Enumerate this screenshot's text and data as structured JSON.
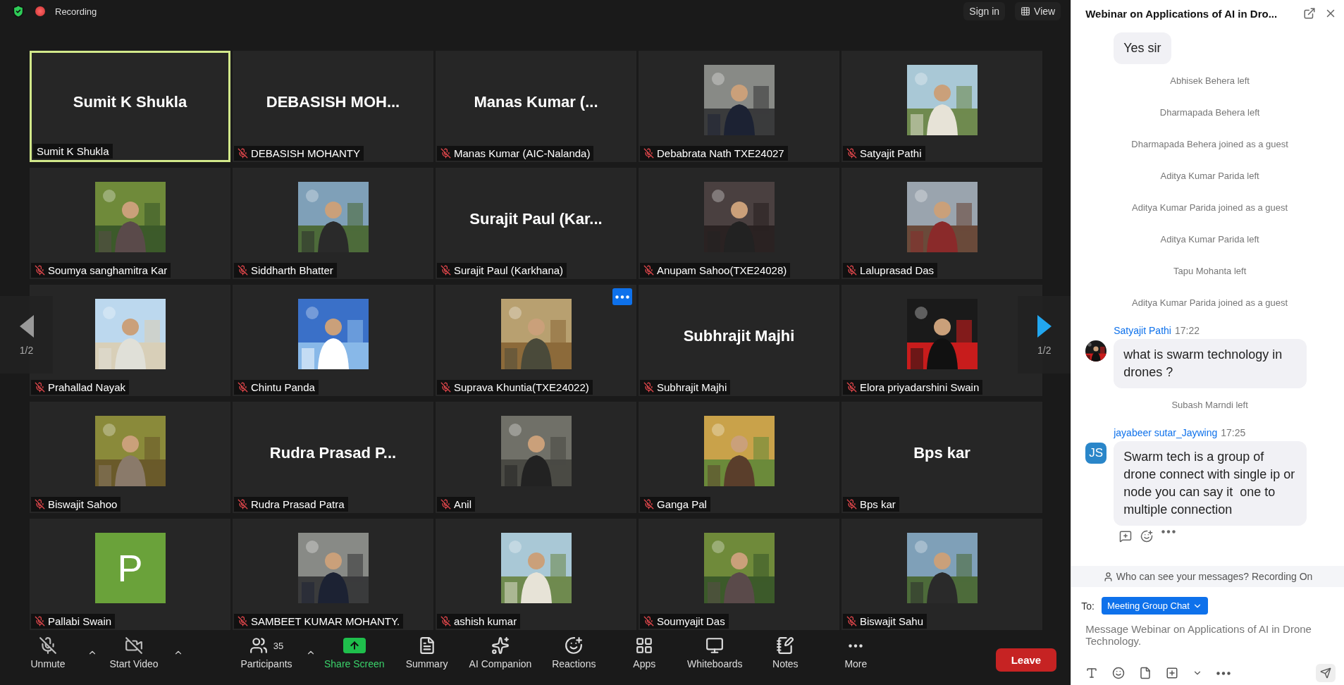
{
  "top_bar": {
    "recording_label": "Recording",
    "sign_in": "Sign in",
    "view": "View"
  },
  "gallery": {
    "page_left": "1/2",
    "page_right": "1/2",
    "tiles": [
      {
        "kind": "name",
        "display_name": "Sumit K Shukla",
        "label": "Sumit K Shukla",
        "muted": false,
        "active": true,
        "hovered": false
      },
      {
        "kind": "name",
        "display_name": "DEBASISH  MOH...",
        "label": "DEBASISH MOHANTY",
        "muted": true,
        "active": false,
        "hovered": false
      },
      {
        "kind": "name",
        "display_name": "Manas Kumar (...",
        "label": "Manas Kumar (AIC-Nalanda)",
        "muted": true,
        "active": false,
        "hovered": false
      },
      {
        "kind": "picture",
        "label": "Debabrata Nath TXE24027",
        "muted": true,
        "active": false,
        "hovered": false
      },
      {
        "kind": "picture",
        "label": "Satyajit Pathi",
        "muted": true,
        "active": false,
        "hovered": false
      },
      {
        "kind": "picture",
        "label": "Soumya sanghamitra Kar",
        "muted": true,
        "active": false,
        "hovered": false
      },
      {
        "kind": "picture",
        "label": "Siddharth Bhatter",
        "muted": true,
        "active": false,
        "hovered": false
      },
      {
        "kind": "name",
        "display_name": "Surajit Paul (Kar...",
        "label": "Surajit Paul (Karkhana)",
        "muted": true,
        "active": false,
        "hovered": false
      },
      {
        "kind": "picture",
        "label": "Anupam Sahoo(TXE24028)",
        "muted": true,
        "active": false,
        "hovered": false
      },
      {
        "kind": "picture",
        "label": "Laluprasad Das",
        "muted": true,
        "active": false,
        "hovered": false
      },
      {
        "kind": "picture",
        "label": "Prahallad Nayak",
        "muted": true,
        "active": false,
        "hovered": false
      },
      {
        "kind": "picture",
        "label": "Chintu Panda",
        "muted": true,
        "active": false,
        "hovered": false
      },
      {
        "kind": "picture",
        "label": "Suprava Khuntia(TXE24022)",
        "muted": true,
        "active": false,
        "hovered": true
      },
      {
        "kind": "name",
        "display_name": "Subhrajit Majhi",
        "label": "Subhrajit Majhi",
        "muted": true,
        "active": false,
        "hovered": false
      },
      {
        "kind": "picture",
        "label": "Elora priyadarshini Swain",
        "muted": true,
        "active": false,
        "hovered": false
      },
      {
        "kind": "picture",
        "label": "Biswajit Sahoo",
        "muted": true,
        "active": false,
        "hovered": false
      },
      {
        "kind": "name",
        "display_name": "Rudra Prasad P...",
        "label": "Rudra Prasad Patra",
        "muted": true,
        "active": false,
        "hovered": false
      },
      {
        "kind": "picture",
        "label": "Anil",
        "muted": true,
        "active": false,
        "hovered": false
      },
      {
        "kind": "picture",
        "label": "Ganga Pal",
        "muted": true,
        "active": false,
        "hovered": false
      },
      {
        "kind": "name",
        "display_name": "Bps kar",
        "label": "Bps kar",
        "muted": true,
        "active": false,
        "hovered": false
      },
      {
        "kind": "letter",
        "letter": "P",
        "label": "Pallabi Swain",
        "muted": true,
        "active": false,
        "hovered": false
      },
      {
        "kind": "picture",
        "label": "SAMBEET KUMAR MOHANTY.",
        "muted": true,
        "active": false,
        "hovered": false
      },
      {
        "kind": "picture",
        "label": "ashish kumar",
        "muted": true,
        "active": false,
        "hovered": false
      },
      {
        "kind": "picture",
        "label": "Soumyajit Das",
        "muted": true,
        "active": false,
        "hovered": false
      },
      {
        "kind": "picture",
        "label": "Biswajit Sahu",
        "muted": true,
        "active": false,
        "hovered": false
      }
    ]
  },
  "toolbar": {
    "left_items": [
      {
        "label": "Unmute",
        "kind": "mic-off",
        "caret": true
      },
      {
        "label": "Start Video",
        "kind": "video-off",
        "caret": true
      }
    ],
    "center_items": [
      {
        "label": "Participants",
        "kind": "users",
        "caret": true,
        "badge": "35"
      },
      {
        "label": "Share Screen",
        "kind": "share",
        "caret": false
      },
      {
        "label": "Summary",
        "kind": "summary",
        "caret": false
      },
      {
        "label": "AI Companion",
        "kind": "sparkles",
        "caret": false
      },
      {
        "label": "Reactions",
        "kind": "reactions",
        "caret": false
      },
      {
        "label": "Apps",
        "kind": "apps",
        "caret": false
      },
      {
        "label": "Whiteboards",
        "kind": "whiteboard",
        "caret": false
      },
      {
        "label": "Notes",
        "kind": "notes",
        "caret": false
      },
      {
        "label": "More",
        "kind": "more",
        "caret": false
      }
    ],
    "leave": "Leave"
  },
  "chat": {
    "title": "Webinar on Applications of AI in Dro...",
    "messages": [
      {
        "kind": "bubble",
        "text": "Yes sir"
      },
      {
        "kind": "system",
        "text": "Abhisek Behera left"
      },
      {
        "kind": "system",
        "text": "Dharmapada Behera left"
      },
      {
        "kind": "system",
        "text": "Dharmapada Behera joined as a guest"
      },
      {
        "kind": "system",
        "text": "Aditya Kumar Parida left"
      },
      {
        "kind": "system",
        "text": "Aditya Kumar Parida joined as a guest"
      },
      {
        "kind": "system",
        "text": "Aditya Kumar Parida left"
      },
      {
        "kind": "system",
        "text": "Tapu Mohanta left"
      },
      {
        "kind": "system",
        "text": "Aditya Kumar Parida joined as a guest"
      },
      {
        "kind": "message",
        "sender": "Satyajit Pathi",
        "time": "17:22",
        "text": "what is swarm technology in drones ?",
        "reactions": false
      },
      {
        "kind": "system",
        "text": "Subash Marndi left"
      },
      {
        "kind": "message",
        "sender": "jayabeer sutar_Jaywing",
        "time": "17:25",
        "avatar": {
          "kind": "initials",
          "text": "JS"
        },
        "text": "Swarm tech is a group of drone connect with single ip or node you can say it  one to multiple connection",
        "reactions": true
      }
    ],
    "notice": "Who can see your messages? Recording On",
    "to_label": "To:",
    "recipient": "Meeting Group Chat",
    "input": {
      "placeholder": "Message Webinar on Applications of AI in Drone Technology."
    }
  }
}
